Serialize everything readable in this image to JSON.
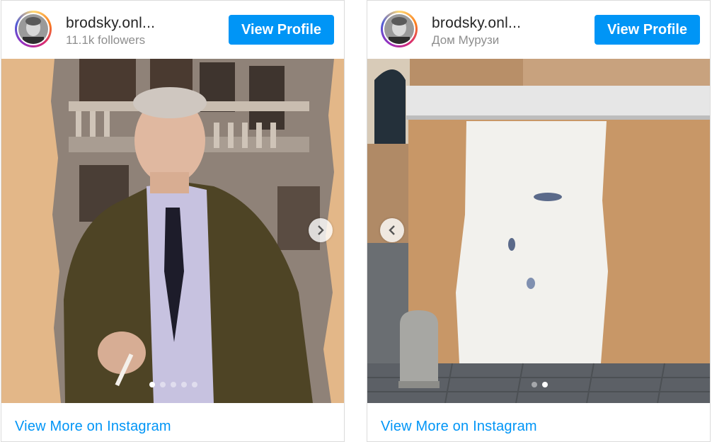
{
  "posts": [
    {
      "username": "brodsky.onl...",
      "subline": "11.1k followers",
      "view_profile_label": "View Profile",
      "footer_label": "View More on Instagram",
      "slide_count": 5,
      "active_slide": 1,
      "arrow": "chevron-right-icon"
    },
    {
      "username": "brodsky.onl...",
      "subline": "Дом Мурузи",
      "view_profile_label": "View Profile",
      "footer_label": "View More on Instagram",
      "slide_count": 2,
      "active_slide": 2,
      "arrow": "chevron-left-icon"
    }
  ],
  "colors": {
    "accent": "#0095f6",
    "border": "#dbdbdb",
    "text": "#262626",
    "muted": "#8e8e8e"
  }
}
